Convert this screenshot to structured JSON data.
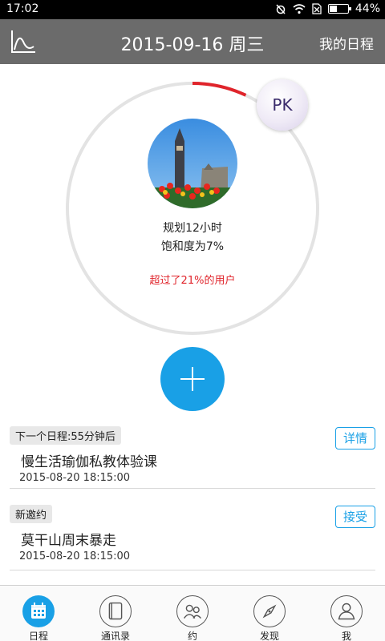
{
  "status_bar": {
    "time": "17:02",
    "battery": "44%",
    "battery_level": 0.44
  },
  "header": {
    "trend_icon": "trend-line-icon",
    "title": "2015-09-16 周三",
    "right_link": "我的日程"
  },
  "summary": {
    "progress": 0.07,
    "pk_label": "PK",
    "plan_text": "规划12小时",
    "saturation_text": "饱和度为7%",
    "exceed_text": "超过了21%的用户"
  },
  "add_button": {
    "icon": "plus-icon"
  },
  "cards": [
    {
      "tag": "下一个日程:55分钟后",
      "title": "慢生活瑜伽私教体验课",
      "time": "2015-08-20 18:15:00",
      "action": "详情"
    },
    {
      "tag": "新邀约",
      "title": "莫干山周末暴走",
      "time": "2015-08-20 18:15:00",
      "action": "接受"
    }
  ],
  "tabs": [
    {
      "label": "日程",
      "icon": "calendar-icon",
      "active": true
    },
    {
      "label": "通讯录",
      "icon": "contacts-book-icon",
      "active": false
    },
    {
      "label": "约",
      "icon": "people-icon",
      "active": false
    },
    {
      "label": "发现",
      "icon": "compass-icon",
      "active": false
    },
    {
      "label": "我",
      "icon": "user-icon",
      "active": false
    }
  ],
  "colors": {
    "accent": "#19a0e6",
    "progress": "#e0242b",
    "header": "#6b6b6b"
  }
}
